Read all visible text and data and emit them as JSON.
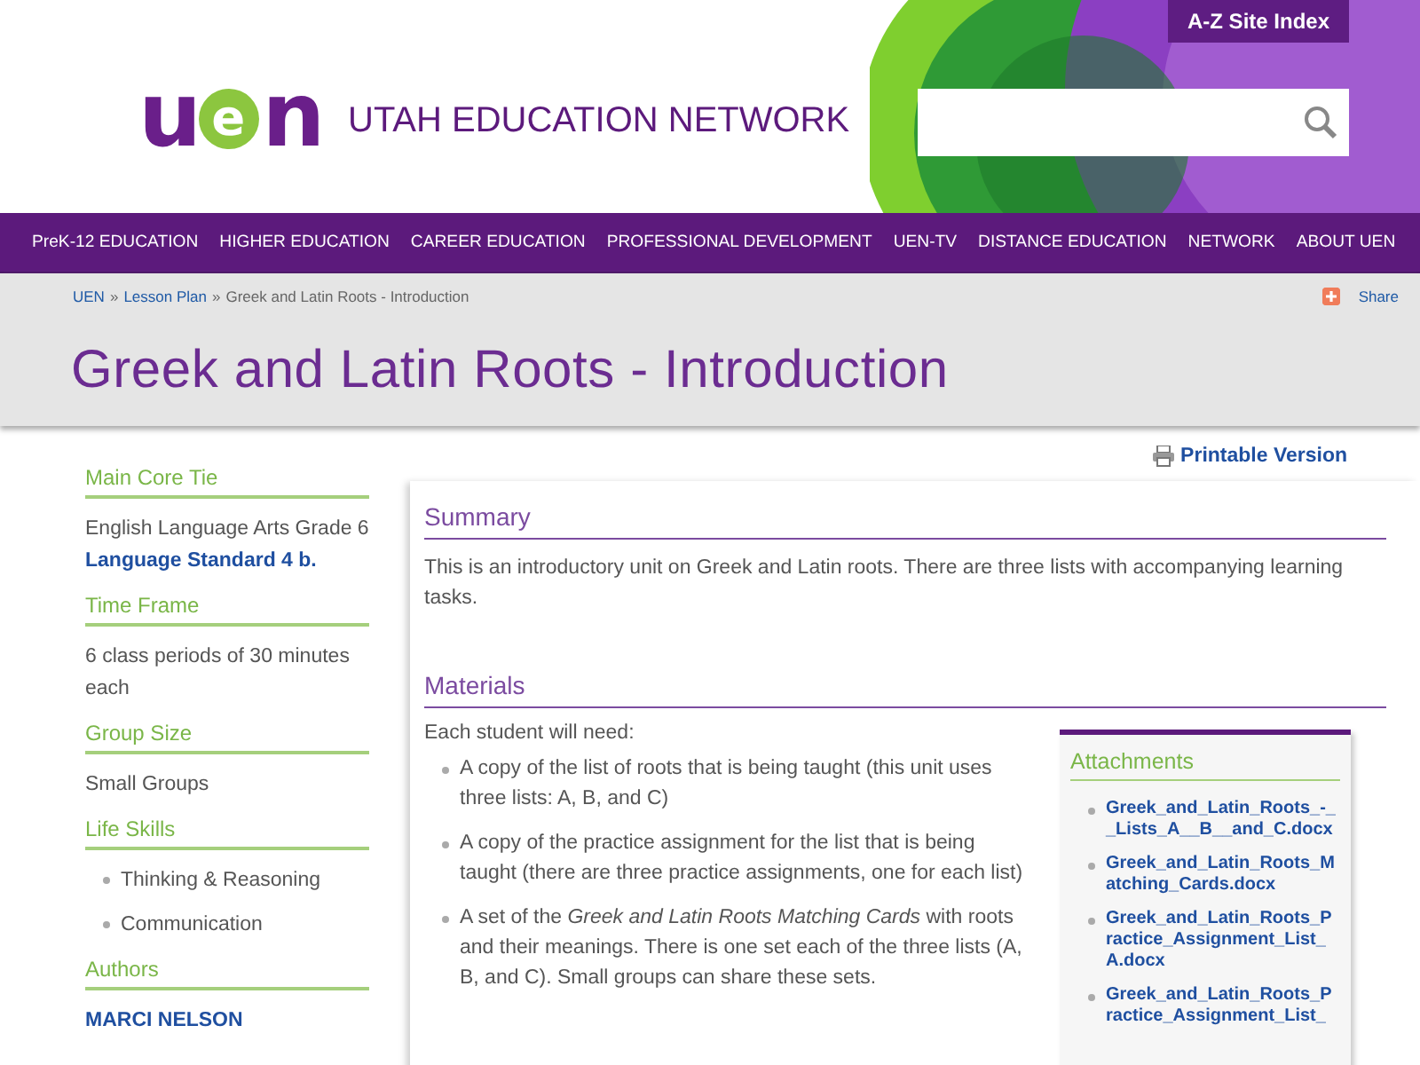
{
  "header": {
    "logo": "uen",
    "network_name": "UTAH EDUCATION NETWORK",
    "site_index_link": "A-Z Site Index"
  },
  "nav": [
    "PreK-12 EDUCATION",
    "HIGHER EDUCATION",
    "CAREER EDUCATION",
    "PROFESSIONAL DEVELOPMENT",
    "UEN-TV",
    "DISTANCE EDUCATION",
    "NETWORK",
    "ABOUT UEN"
  ],
  "breadcrumb": {
    "items": [
      {
        "label": "UEN",
        "link": true
      },
      {
        "label": "Lesson Plan",
        "link": true
      },
      {
        "label": "Greek and Latin Roots - Introduction",
        "link": false
      }
    ],
    "separator": "»"
  },
  "share": "Share",
  "title": "Greek and Latin Roots - Introduction",
  "printable": "Printable Version",
  "sidebar": [
    {
      "heading": "Main Core Tie",
      "kind": "text",
      "lines": [
        {
          "text": "English Language Arts Grade 6",
          "link": false
        },
        {
          "text": "Language Standard 4 b.",
          "link": true
        }
      ]
    },
    {
      "heading": "Time Frame",
      "kind": "text",
      "lines": [
        {
          "text": "6 class periods of 30 minutes each",
          "link": false
        }
      ]
    },
    {
      "heading": "Group Size",
      "kind": "text",
      "lines": [
        {
          "text": "Small Groups",
          "link": false
        }
      ]
    },
    {
      "heading": "Life Skills",
      "kind": "list",
      "lines": [
        {
          "text": "Thinking & Reasoning",
          "link": false
        },
        {
          "text": "Communication",
          "link": false
        }
      ]
    },
    {
      "heading": "Authors",
      "kind": "text",
      "lines": [
        {
          "text": "MARCI NELSON",
          "link": true
        }
      ]
    }
  ],
  "sections": [
    {
      "heading": "Summary",
      "paragraph": "This is an introductory unit on Greek and Latin roots. There are three lists with accompanying learning tasks."
    },
    {
      "heading": "Materials",
      "intro": "Each student will need:",
      "bullets": [
        "A copy of the list of roots that is being taught (this unit uses three lists: A, B, and C)",
        "A copy of the practice assignment for the list that is being taught (there are three practice assignments, one for each list)",
        "A set of the *Greek and Latin Roots Matching Cards* with roots and their meanings. There is one set each of the three lists (A, B, and C). Small groups can share these sets."
      ]
    }
  ],
  "attachments": {
    "heading": "Attachments",
    "files": [
      "Greek_and_Latin_Roots_-__Lists_A__B__and_C.docx",
      "Greek_and_Latin_Roots_Matching_Cards.docx",
      "Greek_and_Latin_Roots_Practice_Assignment_List_A.docx",
      "Greek_and_Latin_Roots_Practice_Assignment_List_"
    ]
  }
}
